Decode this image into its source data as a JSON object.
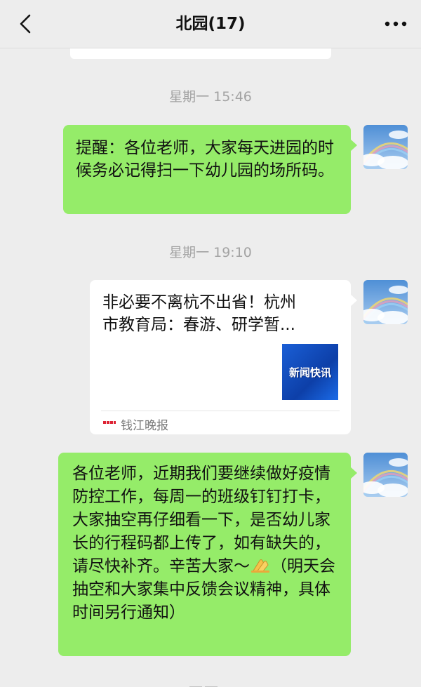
{
  "header": {
    "title": "北园(17)"
  },
  "messages": [
    {
      "timestamp": "星期一 15:46",
      "text": "提醒：各位老师，大家每天进园的时候务必记得扫一下幼儿园的场所码。"
    },
    {
      "timestamp": "星期一 19:10",
      "link_card": {
        "title": "非必要不离杭不出省！杭州\n市教育局：春游、研学暂...",
        "thumbnail_text": "新闻快讯",
        "source": "钱江晚报",
        "source_logo_text": "钱江晚报"
      }
    },
    {
      "text_before_emoji": "各位老师，近期我们要继续做好疫情防控工作，每周一的班级钉钉打卡，大家抽空再仔细看一下，是否幼儿家长的行程码都上传了，如有缺失的，请尽快补齐。辛苦大家～",
      "emoji": "folded-hands-icon",
      "text_after_emoji": "（明天会抽空和大家集中反馈会议精神，具体时间另行通知）"
    }
  ],
  "colors": {
    "background": "#ededed",
    "self_bubble": "#95ec69",
    "card": "#ffffff",
    "timestamp": "#a3a3a3"
  }
}
